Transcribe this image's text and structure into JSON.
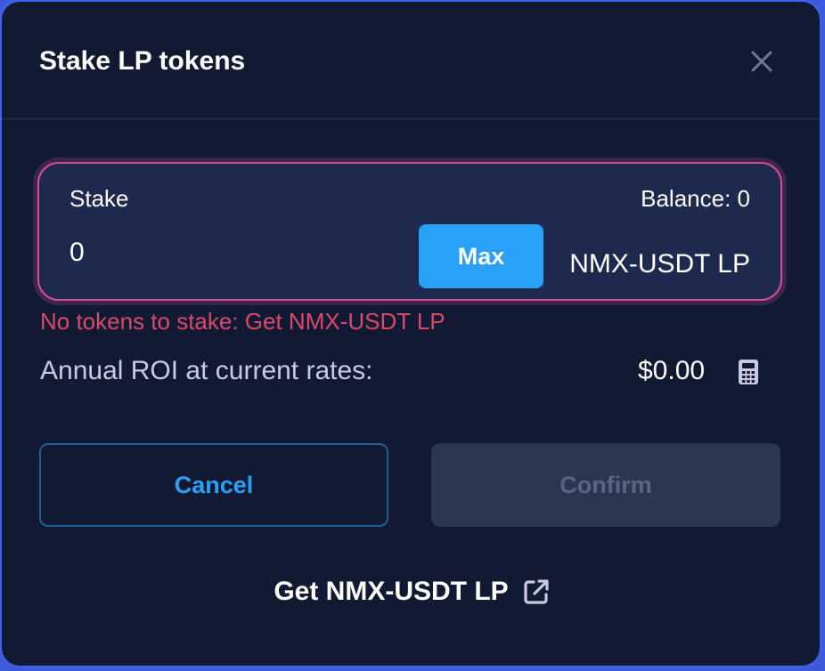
{
  "modal": {
    "title": "Stake LP tokens"
  },
  "stake": {
    "label": "Stake",
    "balance": "Balance: 0",
    "amount": "0",
    "max_label": "Max",
    "token": "NMX-USDT LP"
  },
  "error": "No tokens to stake: Get NMX-USDT LP",
  "roi": {
    "label": "Annual ROI at current rates:",
    "value": "$0.00"
  },
  "actions": {
    "cancel_label": "Cancel",
    "confirm_label": "Confirm"
  },
  "get_link": {
    "label": "Get NMX-USDT LP"
  },
  "icons": {
    "close": "close-icon",
    "calculator": "calculator-icon",
    "external": "external-link-icon"
  },
  "colors": {
    "accent": "#2aa1f8",
    "error": "#d9496c",
    "focus_border": "#d34e9e",
    "modal_border": "#3d63f0"
  }
}
